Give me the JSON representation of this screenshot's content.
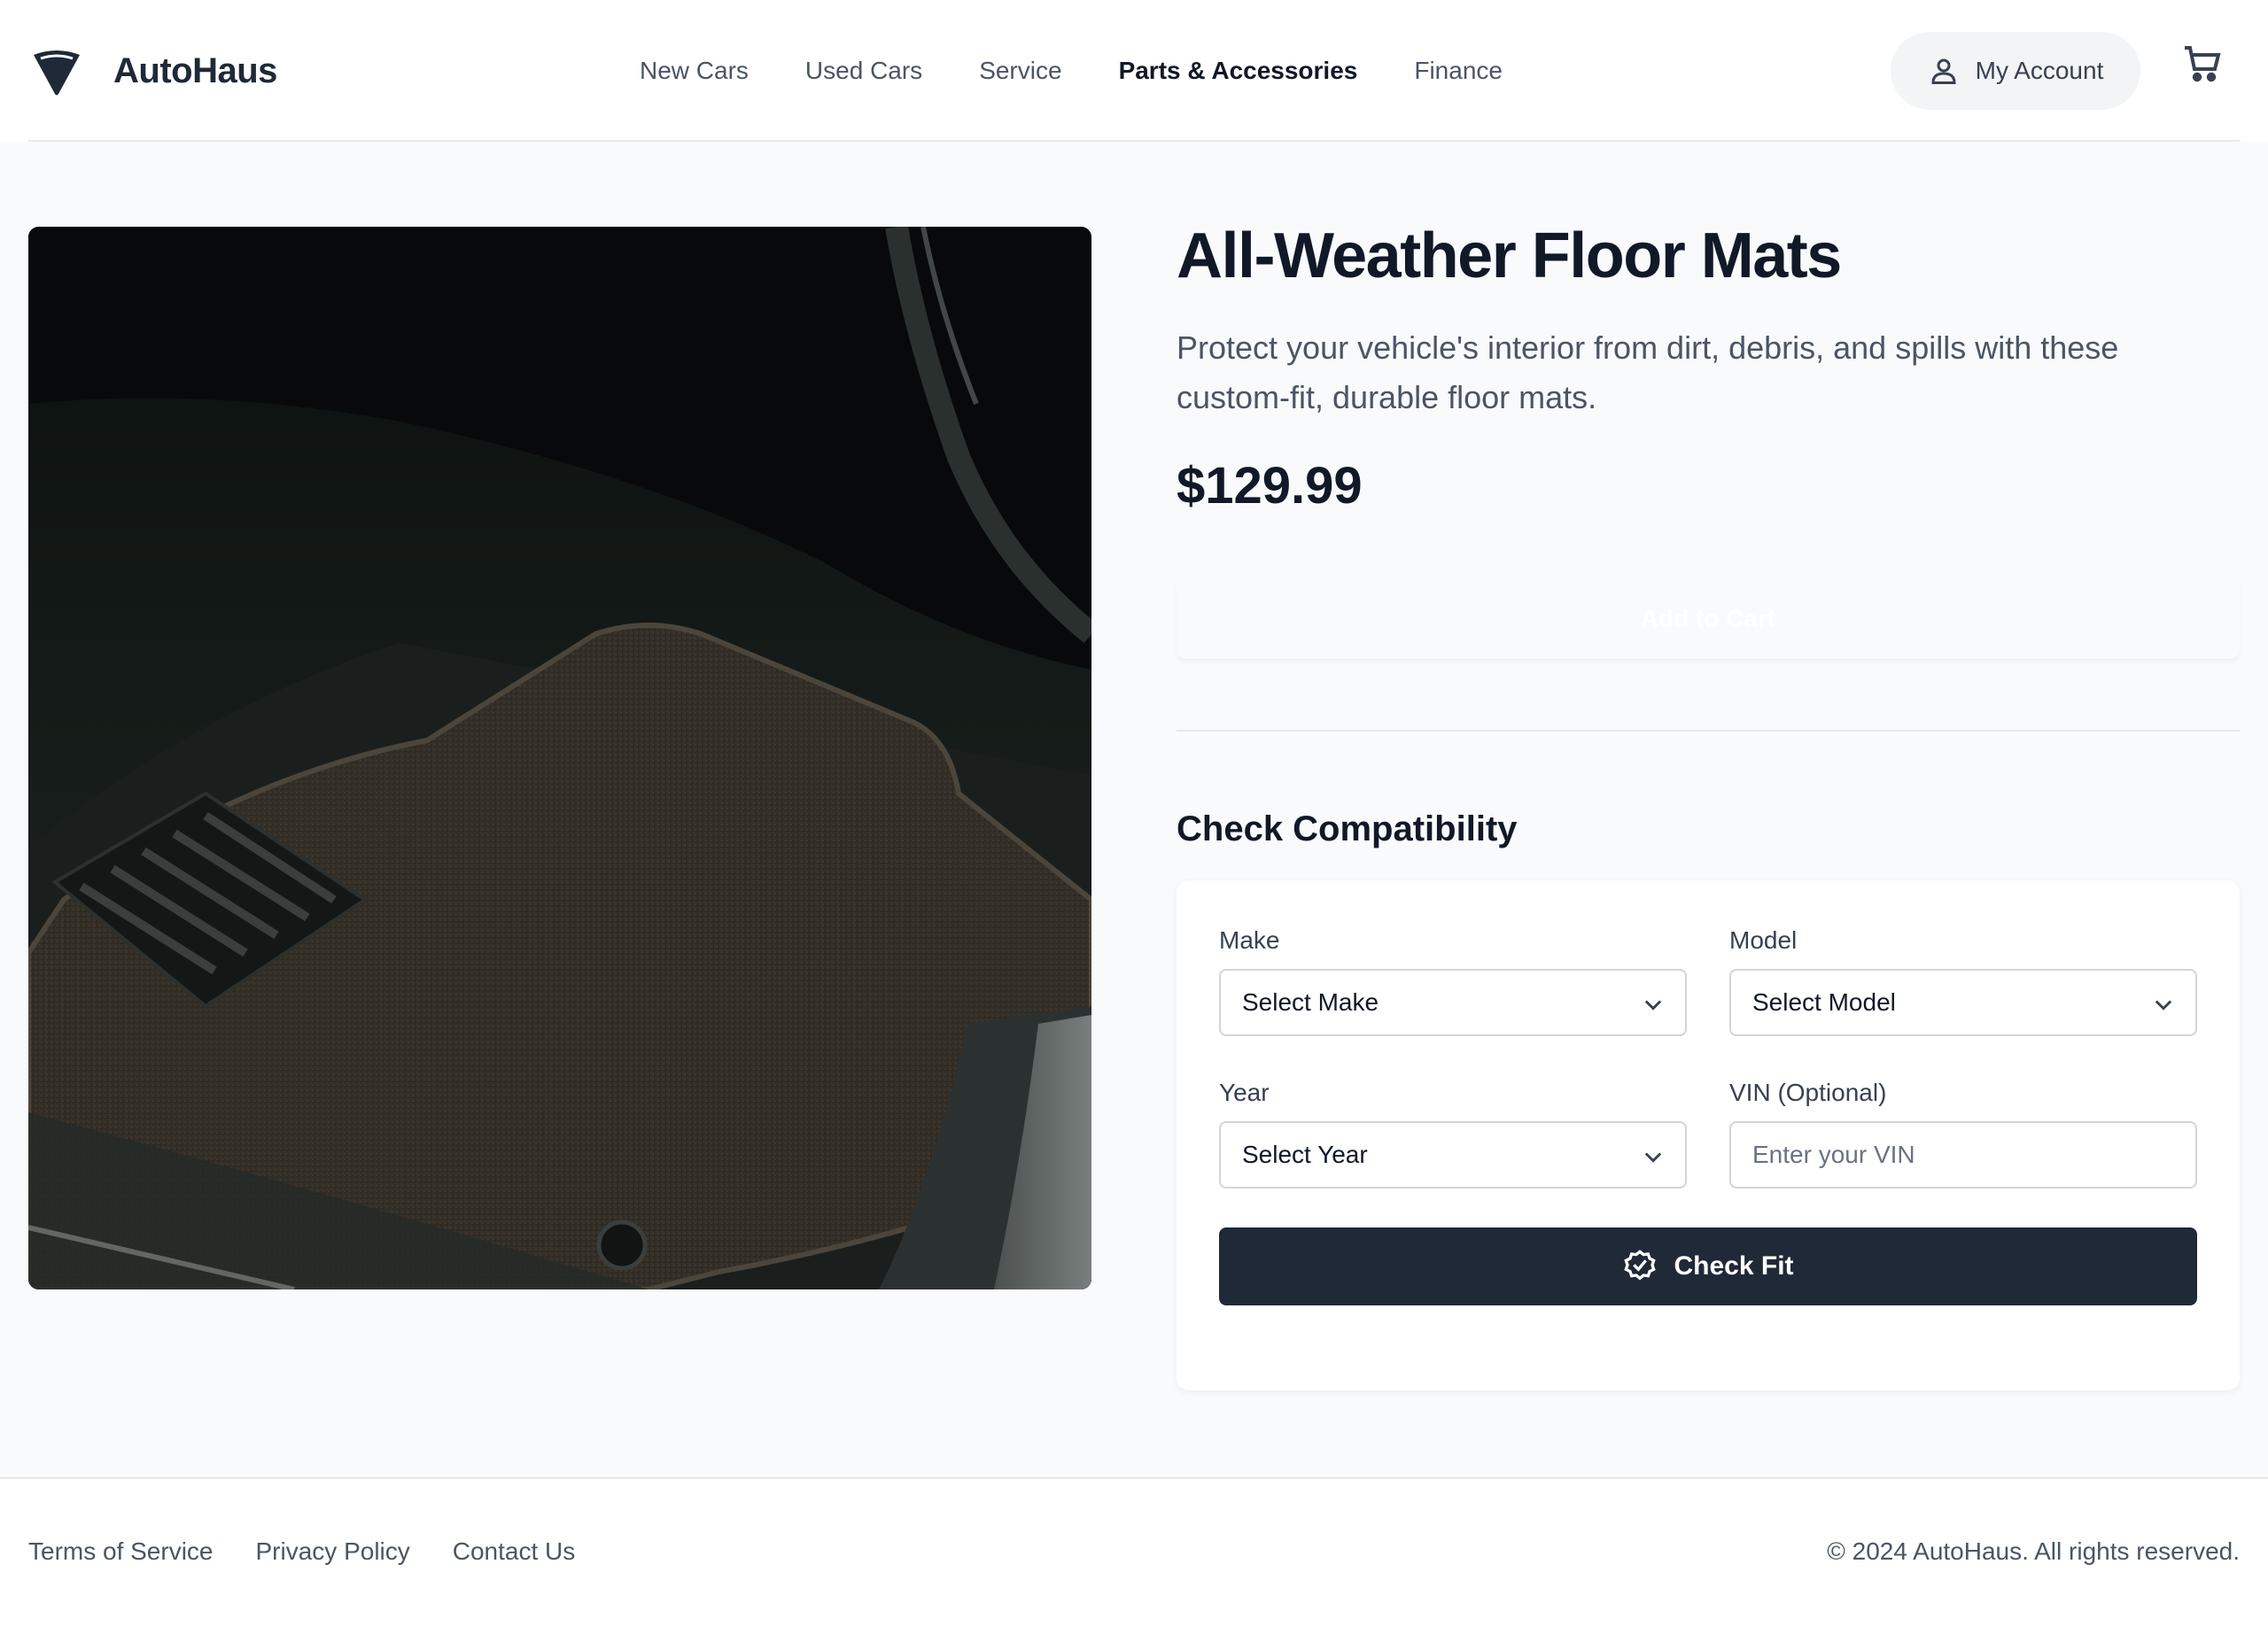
{
  "header": {
    "brand": "AutoHaus",
    "nav": [
      {
        "label": "New Cars",
        "active": false
      },
      {
        "label": "Used Cars",
        "active": false
      },
      {
        "label": "Service",
        "active": false
      },
      {
        "label": "Parts & Accessories",
        "active": true
      },
      {
        "label": "Finance",
        "active": false
      }
    ],
    "account_label": "My Account",
    "icons": {
      "logo": "funnel-logo-icon",
      "account": "user-icon",
      "cart": "cart-icon"
    }
  },
  "product": {
    "title": "All-Weather Floor Mats",
    "description": "Protect your vehicle's interior from dirt, debris, and spills with these custom-fit, durable floor mats.",
    "price": "$129.99",
    "add_to_cart_label": "Add to Cart"
  },
  "compatibility": {
    "title": "Check Compatibility",
    "make": {
      "label": "Make",
      "value": "Select Make"
    },
    "model": {
      "label": "Model",
      "value": "Select Model"
    },
    "year": {
      "label": "Year",
      "value": "Select Year"
    },
    "vin": {
      "label": "VIN (Optional)",
      "placeholder": "Enter your VIN"
    },
    "button_label": "Check Fit"
  },
  "footer": {
    "links": [
      "Terms of Service",
      "Privacy Policy",
      "Contact Us"
    ],
    "copyright": "© 2024 AutoHaus. All rights reserved."
  },
  "colors": {
    "primary_dark": "#1f2937",
    "page_bg": "#f8fafc",
    "text_muted": "#4b5563"
  }
}
